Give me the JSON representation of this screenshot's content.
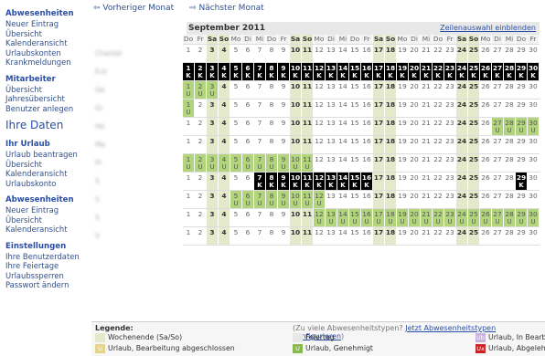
{
  "sidebar": {
    "sections": [
      {
        "title": "Abwesenheiten",
        "links": [
          "Neuer Eintrag",
          "Übersicht",
          "Kalenderansicht",
          "Urlaubskonten",
          "Krankmeldungen"
        ]
      },
      {
        "title": "Mitarbeiter",
        "links": [
          "Übersicht",
          "Jahresübersicht",
          "Benutzer anlegen"
        ]
      }
    ],
    "big_title": "Ihre Daten",
    "sections2": [
      {
        "title": "Ihr Urlaub",
        "links": [
          "Urlaub beantragen",
          "Übersicht",
          "Kalenderansicht",
          "Urlaubskonto"
        ]
      },
      {
        "title": "Abwesenheiten",
        "links": [
          "Neuer Eintrag",
          "Übersicht",
          "Kalenderansicht"
        ]
      },
      {
        "title": "Einstellungen",
        "links": [
          "Ihre Benutzerdaten",
          "Ihre Feiertage",
          "Urlaubssperren",
          "Passwort ändern"
        ]
      }
    ]
  },
  "nav": {
    "prev": "⇦ Vorheriger Monat",
    "next": "⇨ Nächster Monat"
  },
  "calendar": {
    "month": "September 2011",
    "toggle": "Zeilenauswahl einblenden",
    "weekdays": [
      "Do",
      "Fr",
      "Sa",
      "So",
      "Mo",
      "Di",
      "Mi",
      "Do",
      "Fr",
      "Sa",
      "So",
      "Mo",
      "Di",
      "Mi",
      "Do",
      "Fr",
      "Sa",
      "So",
      "Mo",
      "Di",
      "Mi",
      "Do",
      "Fr",
      "Sa",
      "So",
      "Mo",
      "Di",
      "Mi",
      "Do",
      "Fr"
    ],
    "days": [
      "1",
      "2",
      "3",
      "4",
      "5",
      "6",
      "7",
      "8",
      "9",
      "10",
      "11",
      "12",
      "13",
      "14",
      "15",
      "16",
      "17",
      "18",
      "19",
      "20",
      "21",
      "22",
      "23",
      "24",
      "25",
      "26",
      "27",
      "28",
      "29",
      "30"
    ],
    "names": [
      "Chantal",
      "Eck",
      "Ge",
      "Gr",
      "He",
      "Me",
      "Pr",
      "S",
      "S",
      "S",
      "V"
    ],
    "rows": [
      {
        "k": [],
        "u": [],
        "cells": []
      },
      {
        "k": [
          1,
          2,
          3,
          4,
          5,
          6,
          7,
          8,
          9,
          10,
          11,
          12,
          13,
          14,
          15,
          16,
          17,
          18,
          19,
          20,
          21,
          22,
          23,
          24,
          25,
          26,
          27,
          28,
          29,
          30
        ],
        "u": []
      },
      {
        "k": [],
        "u": [
          1,
          2,
          3
        ]
      },
      {
        "k": [],
        "u": [
          1
        ]
      },
      {
        "k": [],
        "u": [
          27,
          28,
          29,
          30
        ]
      },
      {
        "k": [],
        "u": []
      },
      {
        "k": [],
        "u": [
          1,
          2,
          3,
          4,
          5,
          6,
          7,
          8,
          9,
          10,
          11
        ]
      },
      {
        "k": [
          7,
          8,
          9,
          10,
          11,
          12,
          13,
          14,
          15,
          16,
          29
        ],
        "u": []
      },
      {
        "k": [],
        "u": [
          5,
          6,
          7,
          8,
          9,
          10,
          11,
          12
        ]
      },
      {
        "k": [],
        "u": [
          12,
          13,
          14,
          15,
          16,
          17,
          18,
          19,
          20,
          21,
          22,
          23,
          24,
          25,
          26,
          27,
          28,
          29,
          30
        ]
      },
      {
        "k": [],
        "u": []
      }
    ],
    "mark_k": "K",
    "mark_u": "U"
  },
  "legend": {
    "title": "Legende:",
    "hint": "(Zu viele Abwesenheitstypen?",
    "config": "Jetzt Abwesenheitstypen konfigurieren",
    "hint_end": ")",
    "items": [
      {
        "label": "Wochenende (Sa/So)",
        "code": "",
        "color": "#e4e9cc"
      },
      {
        "label": "Feiertag",
        "code": "",
        "color": "#e8e8e8"
      },
      {
        "label": "Urlaub, In Bearbeitung",
        "code": "Ub",
        "color": "#c8b0e0"
      },
      {
        "label": "Urlaub, Bearbeitung abgeschlossen",
        "code": "U",
        "color": "#e6d48a"
      },
      {
        "label": "Urlaub, Genehmigt",
        "code": "U",
        "color": "#8ab850"
      },
      {
        "label": "Urlaub, Abgelehnt",
        "code": "Ux",
        "color": "#cc2222"
      }
    ]
  }
}
